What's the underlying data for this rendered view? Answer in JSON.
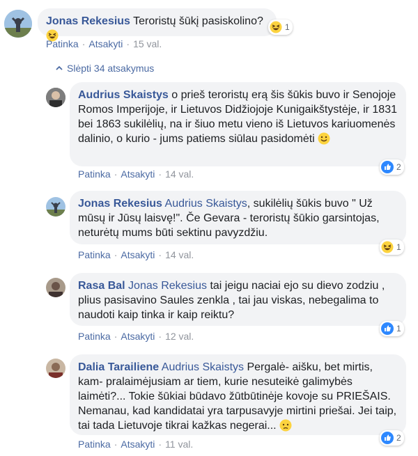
{
  "actions": {
    "like": "Patinka",
    "reply": "Atsakyti"
  },
  "toggle": {
    "label": "Slėpti 34 atsakymus"
  },
  "comments": [
    {
      "author": "Jonas Rekesius",
      "mention": "",
      "text": "Teroristų šūkį pasiskolino?",
      "time": "15 val.",
      "reaction": {
        "type": "haha-icon",
        "count": "1"
      }
    },
    {
      "author": "Audrius Skaistys",
      "mention": "",
      "text": "o prieš teroristų erą šis šūkis buvo ir Senojoje Romos Imperijoje, ir Lietuvos Didžiojoje Kunigaikštystėje, ir 1831 bei 1863 sukilėlių, na ir šiuo metu vieno iš Lietuvos kariuomenės dalinio, o kurio - jums patiems siūlau pasidomėti",
      "time": "14 val.",
      "reaction": {
        "type": "like-icon",
        "count": "2"
      }
    },
    {
      "author": "Jonas Rekesius",
      "mention": "Audrius Skaistys",
      "text": ", sukilėlių šūkis buvo \" Už mūsų ir Jūsų laisvę!\". Če Gevara - teroristų šūkio garsintojas, neturėtų mums būti sektinu pavyzdžiu.",
      "time": "14 val.",
      "reaction": {
        "type": "haha-icon",
        "count": "1"
      }
    },
    {
      "author": "Rasa Bal",
      "mention": "Jonas Rekesius",
      "text": "tai jeigu naciai ejo su dievo zodziu , plius pasisavino Saules zenkla , tai jau viskas, nebegalima to naudoti kaip tinka ir kaip reiktu?",
      "time": "12 val.",
      "reaction": {
        "type": "like-icon",
        "count": "1"
      }
    },
    {
      "author": "Dalia Tarailiene",
      "mention": "Audrius Skaistys",
      "text": "Pergalė- aišku, bet mirtis, kam- pralaimėjusiam ar tiem, kurie nesuteikė galimybės laimėti?... Tokie šūkiai būdavo žūtbūtinėje kovoje su PRIEŠAIS. Nemanau, kad kandidatai yra tarpusavyje mirtini priešai. Jei taip, tai tada Lietuvoje tikrai kažkas negerai...",
      "time": "11 val.",
      "reaction": {
        "type": "like-icon",
        "count": "2"
      }
    }
  ]
}
